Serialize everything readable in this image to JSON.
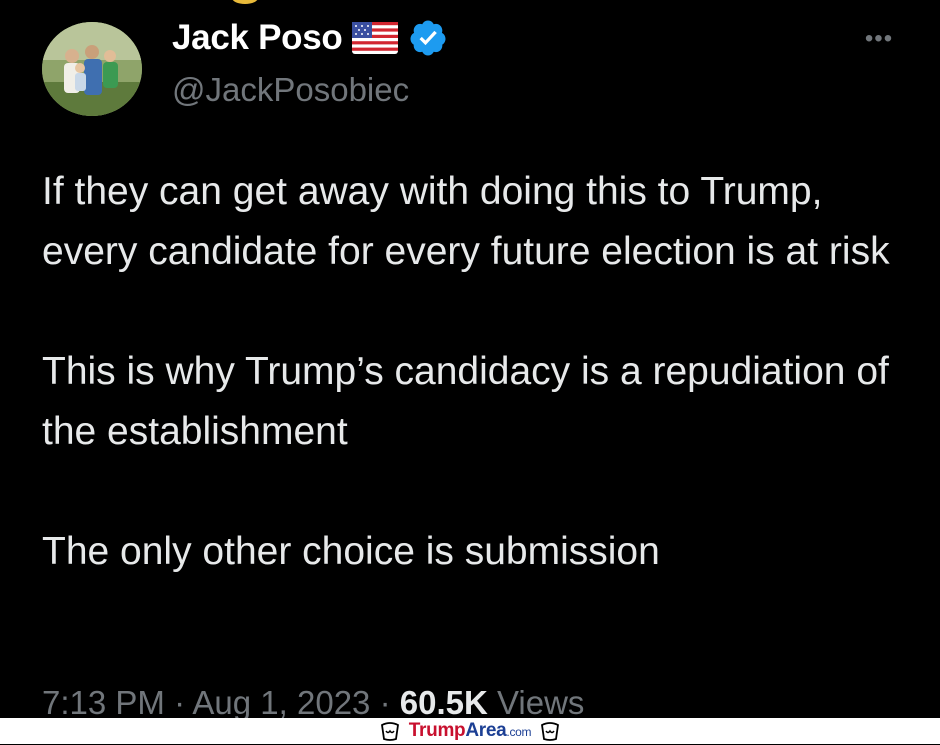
{
  "tweet": {
    "author": {
      "display_name": "Jack Poso",
      "handle": "@JackPosobiec",
      "flag_icon": "us-flag-icon",
      "verified_icon": "verified-badge-icon",
      "verified_color": "#1d9bf0"
    },
    "more_icon": "more-options-icon",
    "more_label": "•••",
    "paragraphs": [
      "If they can get away with doing this to Trump, every candidate for every future election is at risk",
      "This is why Trump’s candidacy is a repudiation of the establishment",
      "The only other choice is submission"
    ],
    "meta": {
      "time": "7:13 PM",
      "separator": " · ",
      "date": "Aug 1, 2023",
      "views_count": "60.5K",
      "views_label": " Views"
    }
  },
  "watermark": {
    "brand_part1": "Trump",
    "brand_part2": "Area",
    "brand_part3": ".com",
    "icon": "cup-icon",
    "colors": {
      "red": "#c8102e",
      "blue": "#1c3f94"
    }
  },
  "colors": {
    "background": "#000000",
    "text_primary": "#e7e9ea",
    "text_secondary": "#71767b"
  }
}
